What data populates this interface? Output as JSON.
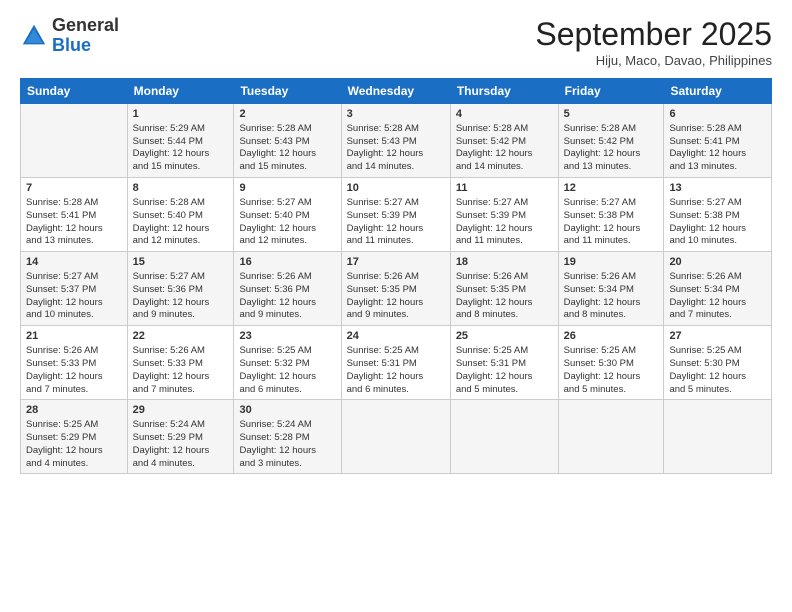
{
  "header": {
    "logo": {
      "general": "General",
      "blue": "Blue"
    },
    "title": "September 2025",
    "location": "Hiju, Maco, Davao, Philippines"
  },
  "calendar": {
    "days": [
      "Sunday",
      "Monday",
      "Tuesday",
      "Wednesday",
      "Thursday",
      "Friday",
      "Saturday"
    ],
    "weeks": [
      [
        {
          "day": "",
          "info": ""
        },
        {
          "day": "1",
          "info": "Sunrise: 5:29 AM\nSunset: 5:44 PM\nDaylight: 12 hours\nand 15 minutes."
        },
        {
          "day": "2",
          "info": "Sunrise: 5:28 AM\nSunset: 5:43 PM\nDaylight: 12 hours\nand 15 minutes."
        },
        {
          "day": "3",
          "info": "Sunrise: 5:28 AM\nSunset: 5:43 PM\nDaylight: 12 hours\nand 14 minutes."
        },
        {
          "day": "4",
          "info": "Sunrise: 5:28 AM\nSunset: 5:42 PM\nDaylight: 12 hours\nand 14 minutes."
        },
        {
          "day": "5",
          "info": "Sunrise: 5:28 AM\nSunset: 5:42 PM\nDaylight: 12 hours\nand 13 minutes."
        },
        {
          "day": "6",
          "info": "Sunrise: 5:28 AM\nSunset: 5:41 PM\nDaylight: 12 hours\nand 13 minutes."
        }
      ],
      [
        {
          "day": "7",
          "info": "Sunrise: 5:28 AM\nSunset: 5:41 PM\nDaylight: 12 hours\nand 13 minutes."
        },
        {
          "day": "8",
          "info": "Sunrise: 5:28 AM\nSunset: 5:40 PM\nDaylight: 12 hours\nand 12 minutes."
        },
        {
          "day": "9",
          "info": "Sunrise: 5:27 AM\nSunset: 5:40 PM\nDaylight: 12 hours\nand 12 minutes."
        },
        {
          "day": "10",
          "info": "Sunrise: 5:27 AM\nSunset: 5:39 PM\nDaylight: 12 hours\nand 11 minutes."
        },
        {
          "day": "11",
          "info": "Sunrise: 5:27 AM\nSunset: 5:39 PM\nDaylight: 12 hours\nand 11 minutes."
        },
        {
          "day": "12",
          "info": "Sunrise: 5:27 AM\nSunset: 5:38 PM\nDaylight: 12 hours\nand 11 minutes."
        },
        {
          "day": "13",
          "info": "Sunrise: 5:27 AM\nSunset: 5:38 PM\nDaylight: 12 hours\nand 10 minutes."
        }
      ],
      [
        {
          "day": "14",
          "info": "Sunrise: 5:27 AM\nSunset: 5:37 PM\nDaylight: 12 hours\nand 10 minutes."
        },
        {
          "day": "15",
          "info": "Sunrise: 5:27 AM\nSunset: 5:36 PM\nDaylight: 12 hours\nand 9 minutes."
        },
        {
          "day": "16",
          "info": "Sunrise: 5:26 AM\nSunset: 5:36 PM\nDaylight: 12 hours\nand 9 minutes."
        },
        {
          "day": "17",
          "info": "Sunrise: 5:26 AM\nSunset: 5:35 PM\nDaylight: 12 hours\nand 9 minutes."
        },
        {
          "day": "18",
          "info": "Sunrise: 5:26 AM\nSunset: 5:35 PM\nDaylight: 12 hours\nand 8 minutes."
        },
        {
          "day": "19",
          "info": "Sunrise: 5:26 AM\nSunset: 5:34 PM\nDaylight: 12 hours\nand 8 minutes."
        },
        {
          "day": "20",
          "info": "Sunrise: 5:26 AM\nSunset: 5:34 PM\nDaylight: 12 hours\nand 7 minutes."
        }
      ],
      [
        {
          "day": "21",
          "info": "Sunrise: 5:26 AM\nSunset: 5:33 PM\nDaylight: 12 hours\nand 7 minutes."
        },
        {
          "day": "22",
          "info": "Sunrise: 5:26 AM\nSunset: 5:33 PM\nDaylight: 12 hours\nand 7 minutes."
        },
        {
          "day": "23",
          "info": "Sunrise: 5:25 AM\nSunset: 5:32 PM\nDaylight: 12 hours\nand 6 minutes."
        },
        {
          "day": "24",
          "info": "Sunrise: 5:25 AM\nSunset: 5:31 PM\nDaylight: 12 hours\nand 6 minutes."
        },
        {
          "day": "25",
          "info": "Sunrise: 5:25 AM\nSunset: 5:31 PM\nDaylight: 12 hours\nand 5 minutes."
        },
        {
          "day": "26",
          "info": "Sunrise: 5:25 AM\nSunset: 5:30 PM\nDaylight: 12 hours\nand 5 minutes."
        },
        {
          "day": "27",
          "info": "Sunrise: 5:25 AM\nSunset: 5:30 PM\nDaylight: 12 hours\nand 5 minutes."
        }
      ],
      [
        {
          "day": "28",
          "info": "Sunrise: 5:25 AM\nSunset: 5:29 PM\nDaylight: 12 hours\nand 4 minutes."
        },
        {
          "day": "29",
          "info": "Sunrise: 5:24 AM\nSunset: 5:29 PM\nDaylight: 12 hours\nand 4 minutes."
        },
        {
          "day": "30",
          "info": "Sunrise: 5:24 AM\nSunset: 5:28 PM\nDaylight: 12 hours\nand 3 minutes."
        },
        {
          "day": "",
          "info": ""
        },
        {
          "day": "",
          "info": ""
        },
        {
          "day": "",
          "info": ""
        },
        {
          "day": "",
          "info": ""
        }
      ]
    ]
  }
}
